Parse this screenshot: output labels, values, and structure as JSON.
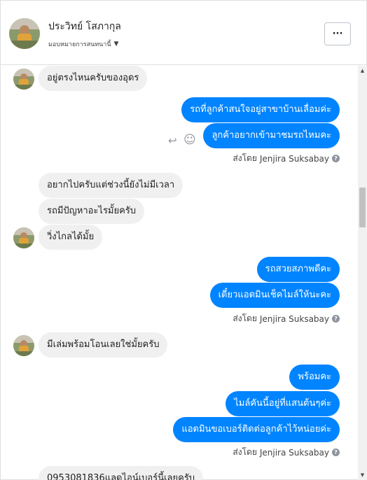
{
  "header": {
    "contact_name": "ประวิทย์ โสภากุล",
    "assign_label": "มอบหมายการสนทนานี้",
    "more_label": "···"
  },
  "messages": {
    "m1": "อยู่ตรงไหนครับของอุดร",
    "m2": "รถที่ลูกค้าสนใจอยู่สาขาบ้านเลื่อมค่ะ",
    "m3": "ลูกค้าอยากเข้ามาชมรถไหมคะ",
    "m4": "อยากไปครับแต่ช่วงนี้ยังไม่มีเวลา",
    "m5": "รถมีปัญหาอะไรมั้ยครับ",
    "m6": "วิ่งไกลได้มั้ย",
    "m7": "รถสวยสภาพดีคะ",
    "m8": "เดี๋ยวแอดมินเช็คไมล์ให้นะคะ",
    "m9": "มีเล่มพร้อมโอนเลยใช่มั้ยครับ",
    "m10": "พร้อมคะ",
    "m11": "ไมล์คันนี้อยู่ที่แสนต้นๆค่ะ",
    "m12": "แอดมินขอเบอร์ติดต่อลูกค้าไว้หน่อยค่ะ",
    "m13": "0953081836แลดไอน์เบอร์นี้เลยครับ"
  },
  "sent_by": {
    "prefix": "ส่งโดย",
    "name": "Jenjira Suksabay",
    "info": "?"
  },
  "icons": [
    "reply-icon",
    "smile-icon",
    "caret-down-icon",
    "more-icon",
    "info-icon"
  ],
  "colors": {
    "outgoing": "#0084ff",
    "incoming": "#f1f0f0"
  }
}
